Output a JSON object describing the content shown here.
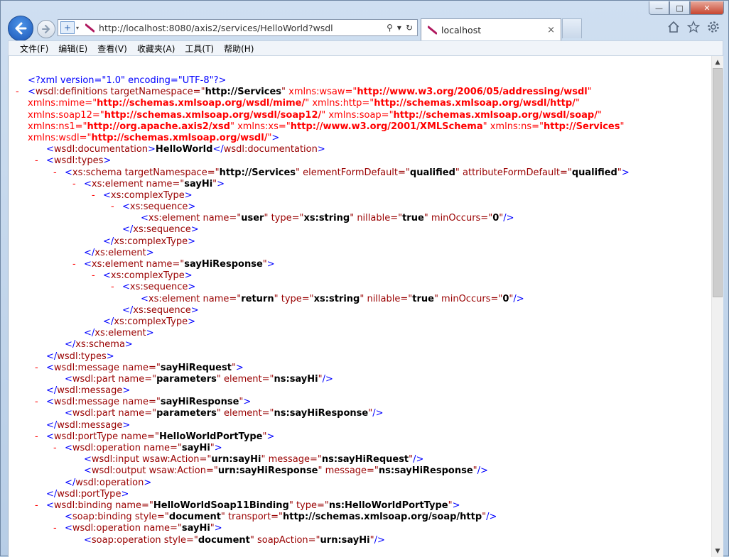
{
  "window": {
    "min_label": "—",
    "max_label": "□",
    "close_label": "✕"
  },
  "nav": {
    "url": "http://localhost:8080/axis2/services/HelloWorld?wsdl",
    "tab_title": "localhost",
    "tab_close": "×",
    "search_glyph": "⚲",
    "dropdown_glyph": "▾",
    "refresh_glyph": "↻"
  },
  "menu": {
    "items": [
      "文件(F)",
      "编辑(E)",
      "查看(V)",
      "收藏夹(A)",
      "工具(T)",
      "帮助(H)"
    ]
  },
  "colors": {
    "back_button": "#1a56b8",
    "tag": "#990000",
    "namespace": "#ff0000",
    "processing": "#0000ff"
  },
  "xml": {
    "decl": "<?xml version=\"1.0\" encoding=\"UTF-8\"?>",
    "defs": {
      "open": "<wsdl:definitions",
      "tns_attr": " targetNamespace=\"",
      "tns_val": "http://Services",
      "wsaw_attr": " xmlns:wsaw=\"",
      "wsaw_val": "http://www.w3.org/2006/05/addressing/wsdl",
      "mime_attr": "xmlns:mime=\"",
      "mime_val": "http://schemas.xmlsoap.org/wsdl/mime/",
      "http_attr": " xmlns:http=\"",
      "http_val": "http://schemas.xmlsoap.org/wsdl/http/",
      "soap12_attr": "xmlns:soap12=\"",
      "soap12_val": "http://schemas.xmlsoap.org/wsdl/soap12/",
      "soap_attr": " xmlns:soap=\"",
      "soap_val": "http://schemas.xmlsoap.org/wsdl/soap/",
      "ns1_attr": "xmlns:ns1=\"",
      "ns1_val": "http://org.apache.axis2/xsd",
      "xs_attr": " xmlns:xs=\"",
      "xs_val": "http://www.w3.org/2001/XMLSchema",
      "ns_attr": " xmlns:ns=\"",
      "ns_val": "http://Services",
      "wsdl_attr": "xmlns:wsdl=\"",
      "wsdl_val": "http://schemas.xmlsoap.org/wsdl/"
    },
    "documentation": "HelloWorld",
    "schema_tns": "http://Services",
    "element_form_default": "qualified",
    "attribute_form_default": "qualified",
    "elem_sayhi": "sayHi",
    "elem_user": "user",
    "type_string": "xs:string",
    "nillable": "true",
    "min_occurs": "0",
    "elem_sayhi_response": "sayHiResponse",
    "elem_return": "return",
    "msg_request": "sayHiRequest",
    "part_name": "parameters",
    "part_el_request": "ns:sayHi",
    "msg_response": "sayHiResponse",
    "part_el_response": "ns:sayHiResponse",
    "porttype_name": "HelloWorldPortType",
    "op_name": "sayHi",
    "input_action": "urn:sayHi",
    "input_message": "ns:sayHiRequest",
    "output_action": "urn:sayHiResponse",
    "output_message": "ns:sayHiResponse",
    "binding_name": "HelloWorldSoap11Binding",
    "binding_type": "ns:HelloWorldPortType",
    "binding_style": "document",
    "binding_transport": "http://schemas.xmlsoap.org/soap/http",
    "soap_op_style": "document",
    "soap_action": "urn:sayHi"
  }
}
